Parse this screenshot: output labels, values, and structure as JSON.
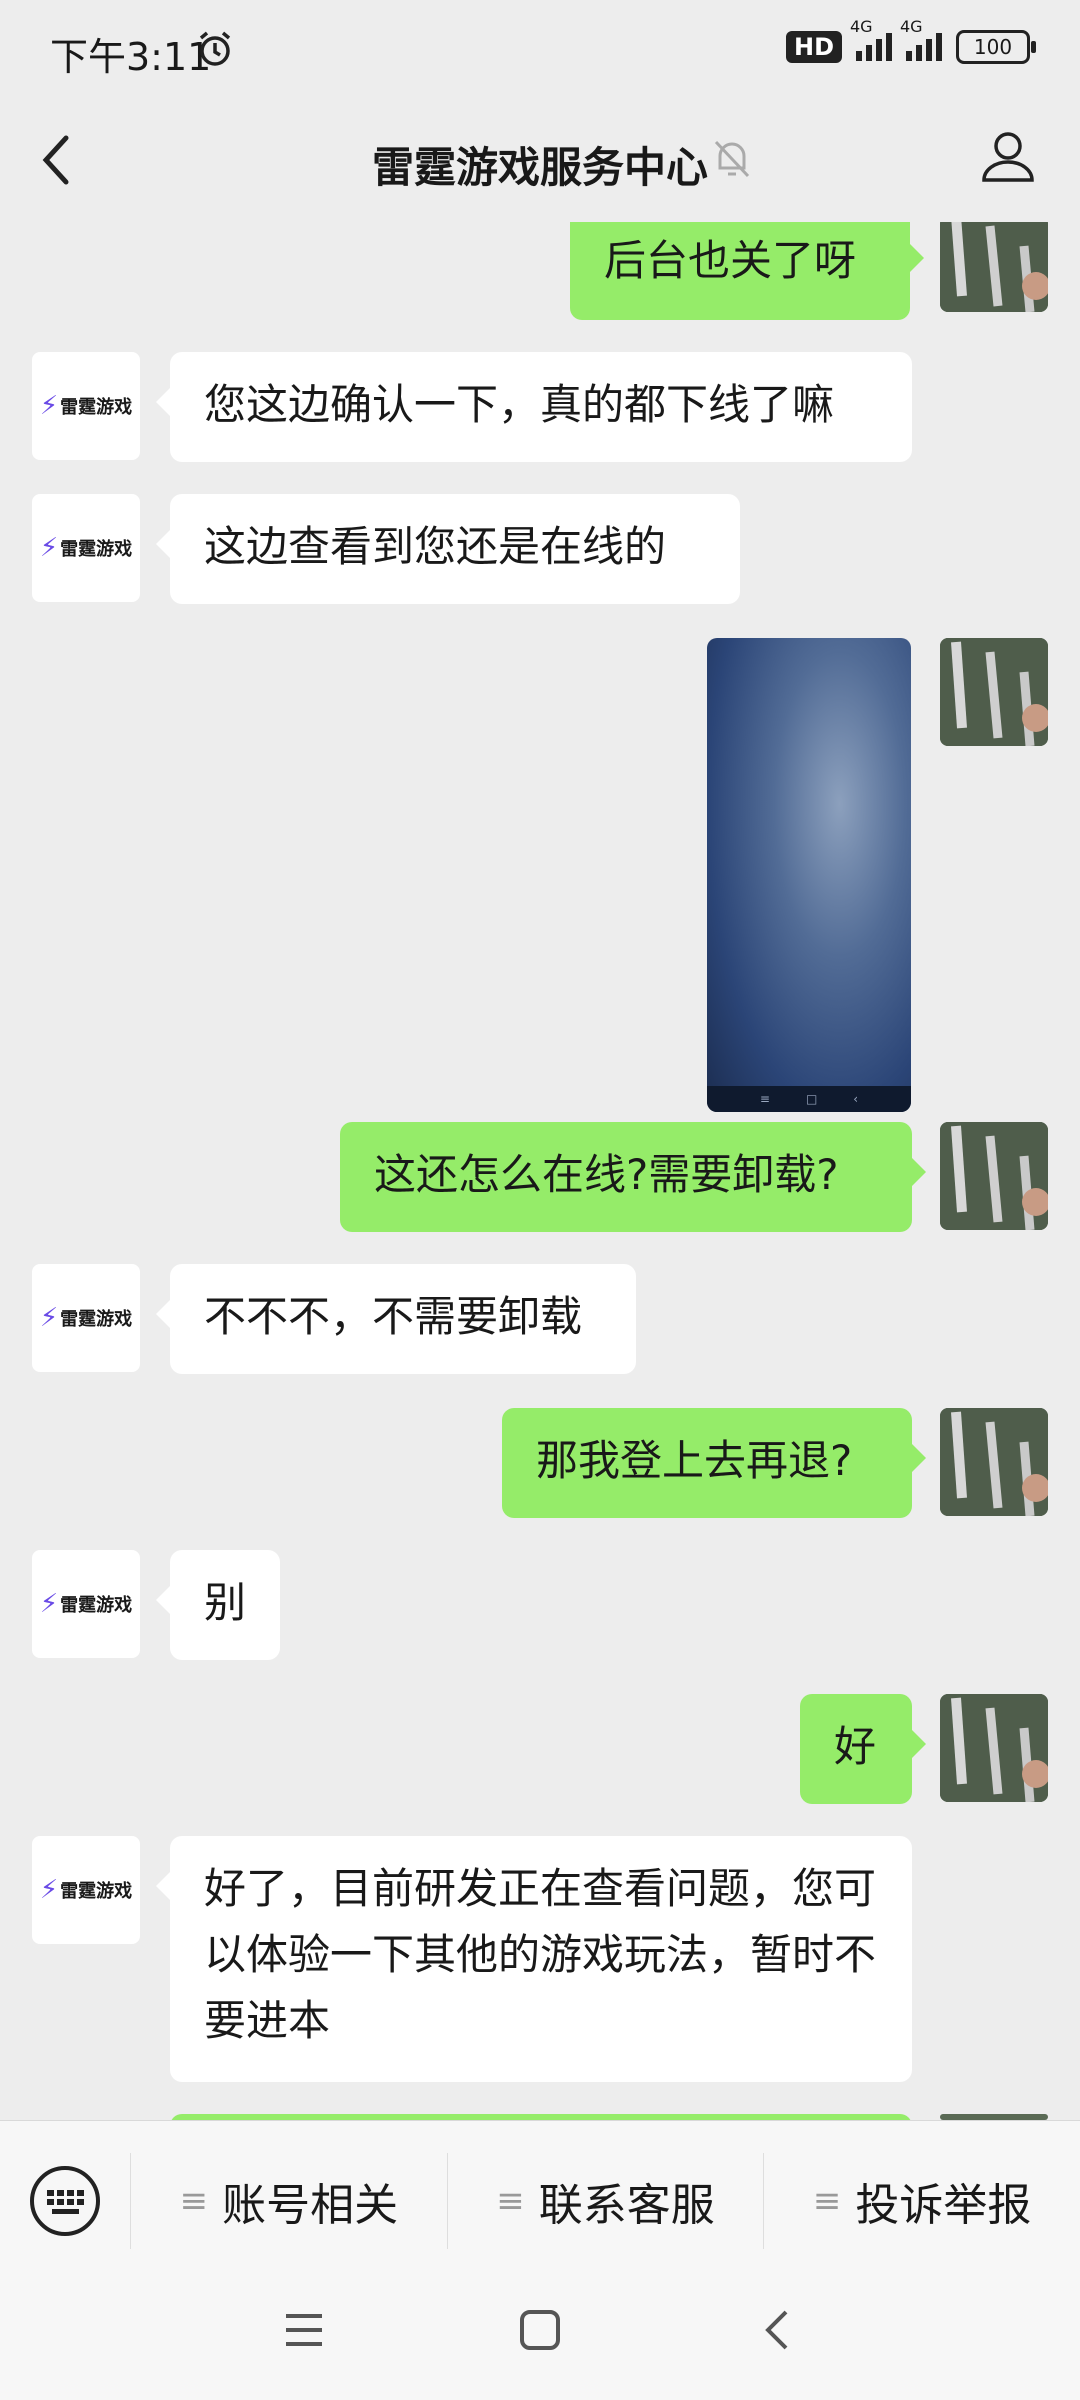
{
  "status_bar": {
    "time": "下午3:11",
    "network_hd": "HD",
    "network_1": "4G",
    "network_2": "4G",
    "battery": "100"
  },
  "nav": {
    "title": "雷霆游戏服务中心"
  },
  "bot": {
    "logo_text": "雷霆游戏"
  },
  "messages": [
    {
      "text": "后台也关了呀"
    },
    {
      "text": "您这边确认一下，真的都下线了嘛"
    },
    {
      "text": "这边查看到您还是在线的"
    },
    {
      "text": "这还怎么在线?需要卸载?"
    },
    {
      "text": "不不不，不需要卸载"
    },
    {
      "text": "那我登上去再退?"
    },
    {
      "text": "别"
    },
    {
      "text": "好"
    },
    {
      "text": "好了，目前研发正在查看问题，您可以体验一下其他的游戏玩法，暂时不要进本"
    }
  ],
  "menu": {
    "items": [
      "账号相关",
      "联系客服",
      "投诉举报"
    ]
  },
  "colors": {
    "background": "#ededed",
    "outgoing_bubble": "#95ec69",
    "incoming_bubble": "#ffffff"
  }
}
